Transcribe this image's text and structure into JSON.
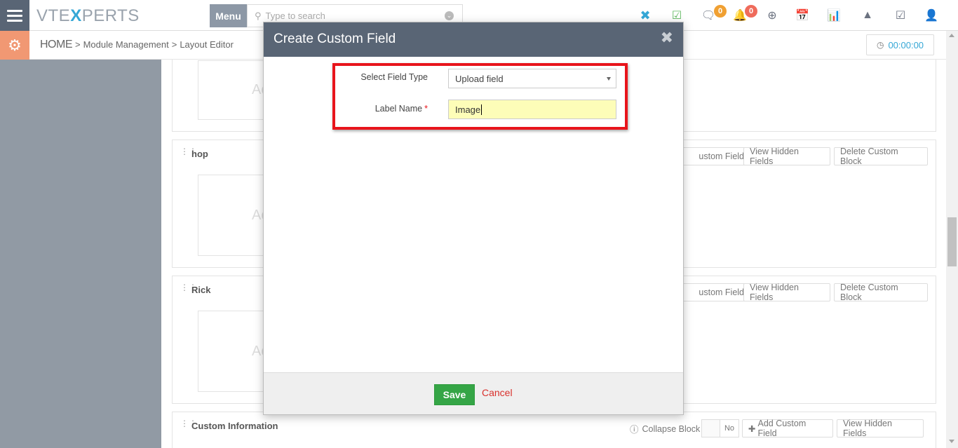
{
  "header": {
    "logo": {
      "left": "VTE",
      "mid": "X",
      "right": "PERTS"
    },
    "menu_label": "Menu",
    "search_placeholder": "Type to search",
    "chat_badge": "0",
    "notification_badge": "0",
    "icons": [
      "x-icon",
      "calendar-check-icon",
      "chat-icon",
      "bell-icon",
      "plus-circle-icon",
      "calendar-icon",
      "bar-chart-icon",
      "area-chart-icon",
      "check-square-icon",
      "user-icon"
    ]
  },
  "subheader": {
    "home": "HOME",
    "crumb_sep": ">",
    "crumb1": "Module Management",
    "crumb_sep2": ">",
    "crumb2": "Layout Editor",
    "timer": "00:00:00"
  },
  "blocks": [
    {
      "name": "",
      "placeholder": "Ac"
    },
    {
      "name": "hop",
      "placeholder": "Ac"
    },
    {
      "name": "Rick",
      "placeholder": "Ac"
    },
    {
      "name": "Custom Information",
      "placeholder": ""
    }
  ],
  "block_buttons": {
    "add_custom_field_partial": "ustom Field",
    "view_hidden": "View Hidden Fields",
    "delete_block": "Delete Custom Block",
    "collapse_label": "Collapse Block",
    "toggle_no": "No",
    "add_custom_field": "Add Custom Field"
  },
  "modal": {
    "title": "Create Custom Field",
    "field_type_label": "Select Field Type",
    "field_type_value": "Upload field",
    "label_name_label": "Label Name",
    "required_mark": "*",
    "label_name_value": "Image",
    "save": "Save",
    "cancel": "Cancel"
  },
  "colors": {
    "header_dark": "#596575",
    "accent_orange": "#f19873",
    "accent_blue": "#35a7d6",
    "save_green": "#35a546",
    "highlight_red": "#e8141b",
    "badge_orange": "#f0a032",
    "badge_red": "#ef6b5b"
  }
}
